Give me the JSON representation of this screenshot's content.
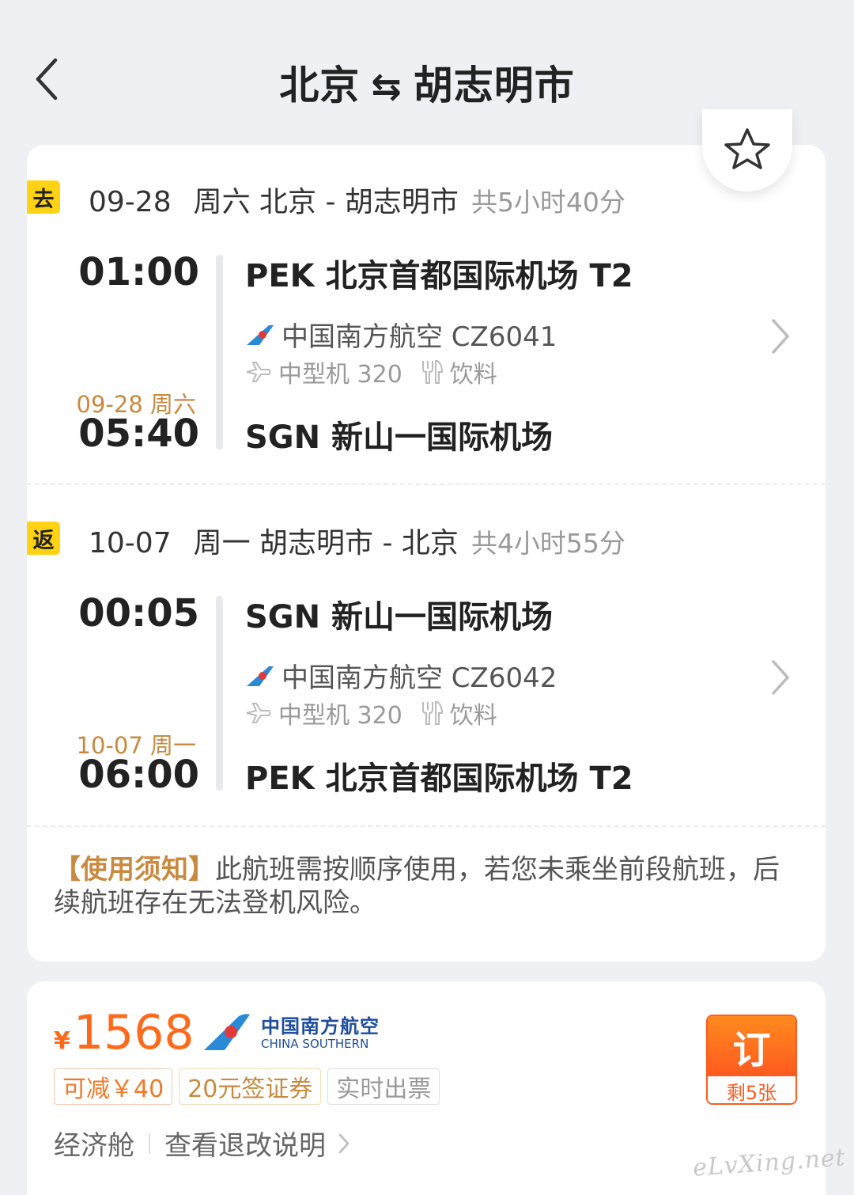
{
  "header": {
    "origin": "北京",
    "swap_symbol": "⇆",
    "destination": "胡志明市"
  },
  "outbound": {
    "tag": "去",
    "date": "09-28",
    "weekday_route": "周六 北京 - 胡志明市",
    "duration": "共5小时40分",
    "depart_time": "01:00",
    "depart_airport": "PEK 北京首都国际机场 T2",
    "airline_flight": "中国南方航空 CZ6041",
    "aircraft": "中型机 320",
    "meal": "饮料",
    "arrive_date": "09-28 周六",
    "arrive_time": "05:40",
    "arrive_airport": "SGN 新山一国际机场"
  },
  "return": {
    "tag": "返",
    "date": "10-07",
    "weekday_route": "周一 胡志明市 - 北京",
    "duration": "共4小时55分",
    "depart_time": "00:05",
    "depart_airport": "SGN 新山一国际机场",
    "airline_flight": "中国南方航空 CZ6042",
    "aircraft": "中型机 320",
    "meal": "饮料",
    "arrive_date": "10-07 周一",
    "arrive_time": "06:00",
    "arrive_airport": "PEK 北京首都国际机场 T2"
  },
  "notice": {
    "title": "【使用须知】",
    "text": "此航班需按顺序使用，若您未乘坐前段航班，后续航班存在无法登机风险。"
  },
  "price_card": {
    "currency": "¥",
    "price": "1568",
    "airline_cn": "中国南方航空",
    "airline_en": "CHINA SOUTHERN",
    "tags": [
      "可减￥40",
      "20元签证券",
      "实时出票"
    ],
    "cabin": "经济舱",
    "refund_link": "查看退改说明",
    "book_label": "订",
    "remaining": "剩5张"
  },
  "watermark": "eLvXing.net",
  "colors": {
    "accent_orange": "#ff6a1a",
    "tag_yellow": "#ffd313",
    "gold_text": "#c98a3f",
    "airline_blue": "#1d4d9c"
  },
  "icons": [
    "back-arrow-icon",
    "star-icon",
    "airline-logo-icon",
    "plane-icon",
    "utensils-icon",
    "chevron-right-icon"
  ]
}
